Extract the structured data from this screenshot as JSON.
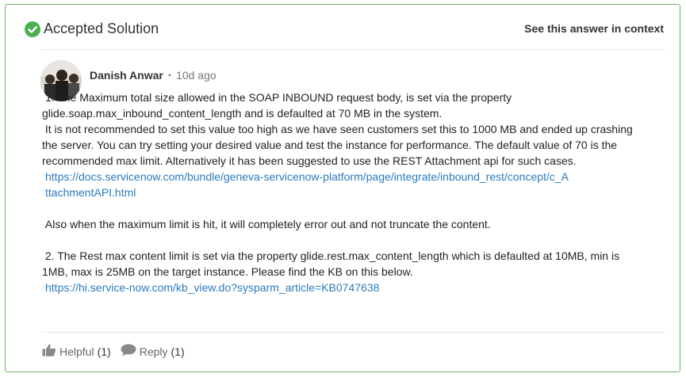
{
  "header": {
    "title": "Accepted Solution",
    "context_link": "See this answer in context",
    "icon": "check-circle-icon",
    "accent": "#4caf50"
  },
  "author": {
    "name": "Danish Anwar",
    "separator": "•",
    "time": "10d ago"
  },
  "content": {
    "p1": " 1. The Maximum total size allowed in the SOAP INBOUND request body, is set via the property glide.soap.max_inbound_content_length and is defaulted at 70 MB in the system.",
    "p2": " It is not recommended to set this value too high as we have seen customers set this to 1000 MB and ended up crashing the server. You can try setting your desired value and test the instance for performance. The default value of 70 is the recommended max limit. Alternatively it has been suggested to use the REST Attachment api for such cases.",
    "link1": "https://docs.servicenow.com/bundle/geneva-servicenow-platform/page/integrate/inbound_rest/concept/c_AttachmentAPI.html",
    "p3": " Also when the maximum limit is hit, it will completely error out and not truncate the content.",
    "p4": " 2. The Rest max content limit is set via the property glide.rest.max_content_length which is defaulted at 10MB, min is 1MB, max is 25MB on the target instance. Please find the KB on this below.",
    "link2": "https://hi.service-now.com/kb_view.do?sysparm_article=KB0747638",
    "link_color": "#2a7bbd"
  },
  "footer": {
    "helpful_label": "Helpful",
    "helpful_count": "(1)",
    "reply_label": "Reply",
    "reply_count": "(1)"
  }
}
